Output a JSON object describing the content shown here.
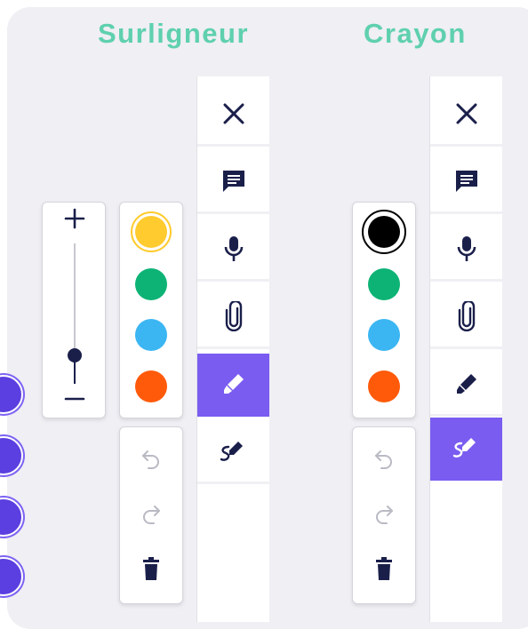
{
  "titles": {
    "left": "Surligneur",
    "right": "Crayon"
  },
  "toolbar_icons": [
    "close-icon",
    "comment-icon",
    "microphone-icon",
    "paperclip-icon",
    "highlighter-icon",
    "pen-icon"
  ],
  "colors": {
    "accent": "#7a5cf0",
    "title": "#5fd0ae",
    "swatches": [
      "#ffcb2e",
      "#0db375",
      "#3bb6f3",
      "#ff5a0a"
    ],
    "pen_swatch_selected": "#000000",
    "icon": "#1a1f4a"
  },
  "left": {
    "active_tool": "highlighter",
    "selected_color": "#ffcb2e",
    "size_level": 0.2
  },
  "right": {
    "active_tool": "pen",
    "selected_color": "#000000"
  },
  "history_icons": [
    "undo-icon",
    "redo-icon",
    "trash-icon"
  ],
  "slider_icons": [
    "plus-icon",
    "minus-icon"
  ]
}
